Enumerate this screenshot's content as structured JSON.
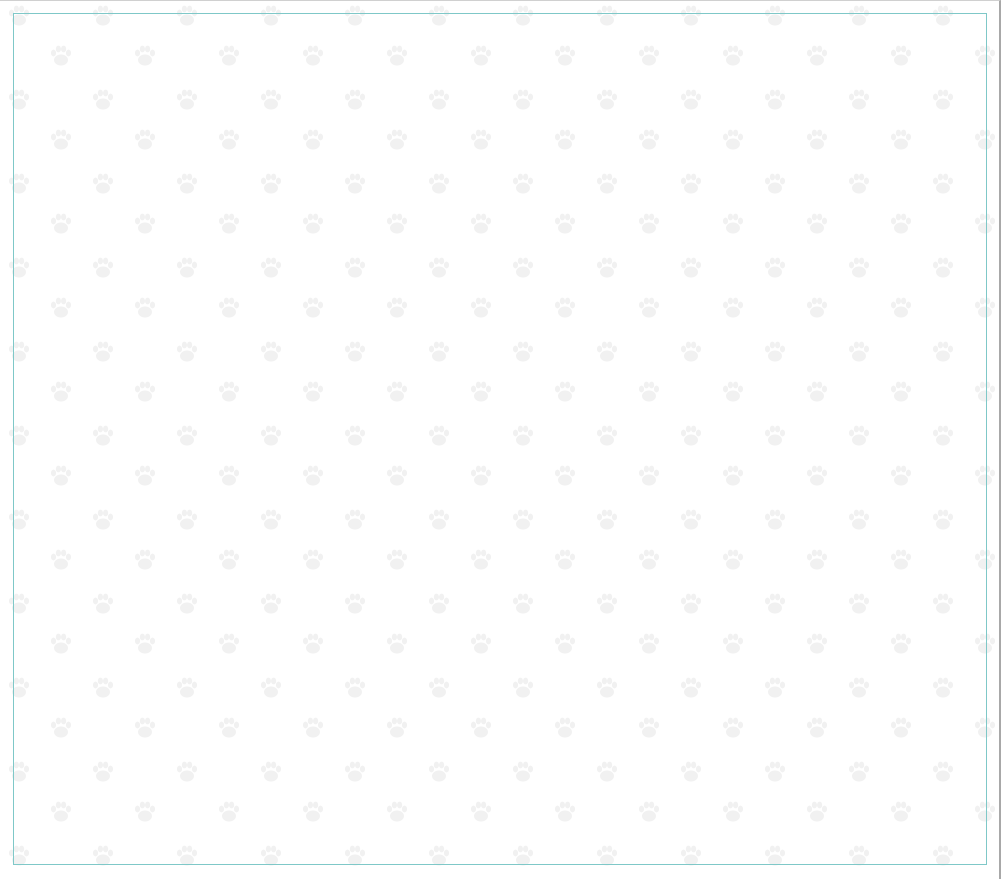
{
  "window": {
    "background_color": "#ffffff",
    "border_color": "#a8a8a8"
  },
  "background_pattern": {
    "icon": "paw-print-icon",
    "icon_color": "#f1f1f1"
  },
  "content_panel": {
    "border_color": "#7fc8c8",
    "content": []
  }
}
